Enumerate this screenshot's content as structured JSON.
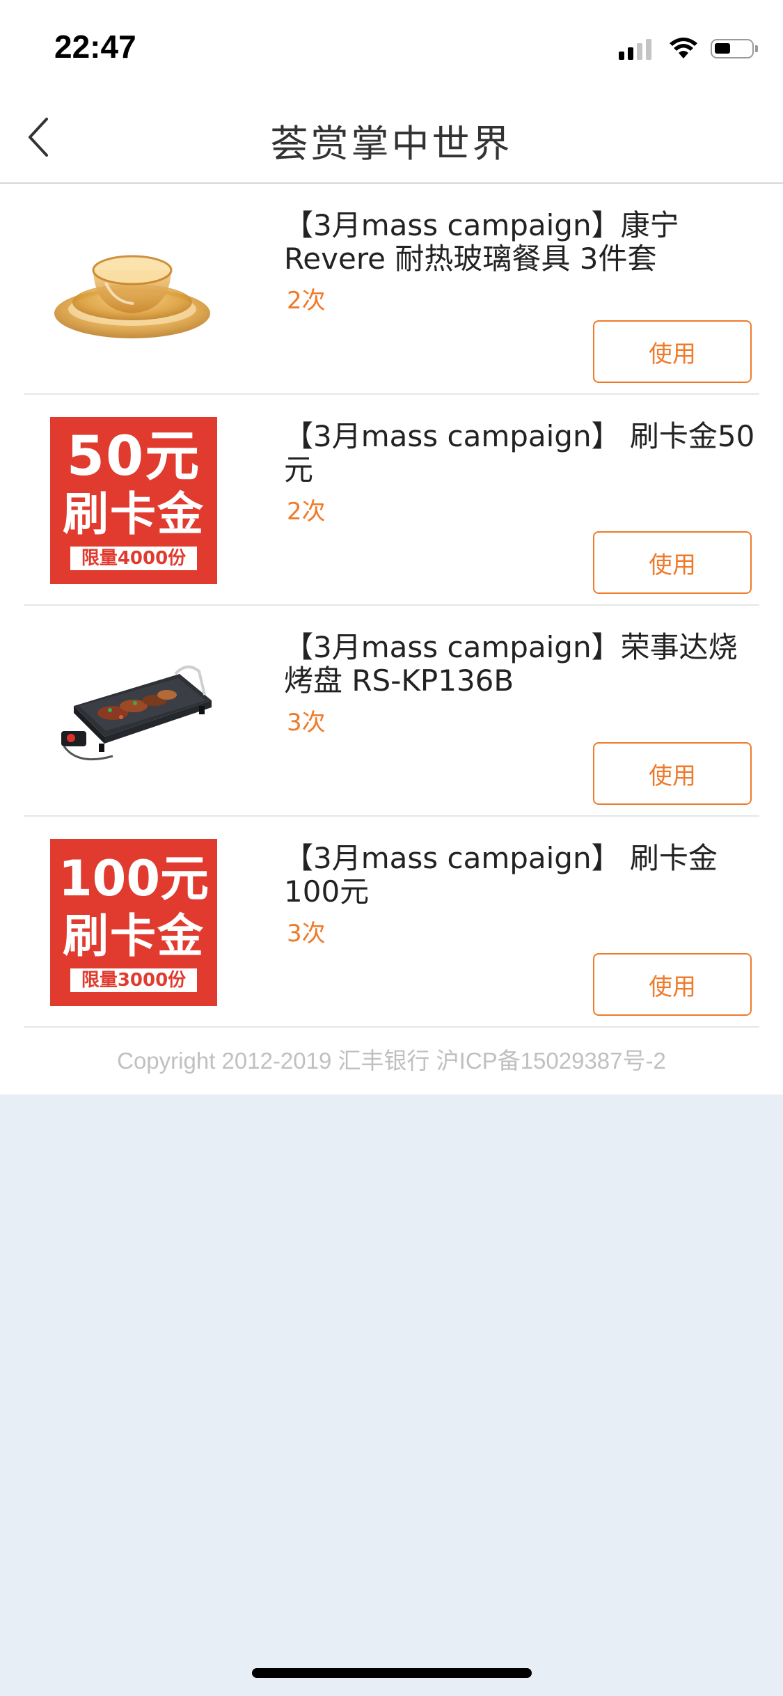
{
  "status_bar": {
    "time": "22:47"
  },
  "nav": {
    "title": "荟赏掌中世界",
    "back_icon": "chevron-left-icon"
  },
  "items": [
    {
      "title": "【3月mass campaign】康宁Revere 耐热玻璃餐具 3件套",
      "count": "2次",
      "button": "使用",
      "image": "amber-glass-dishware"
    },
    {
      "title": "【3月mass campaign】 刷卡金50元",
      "count": "2次",
      "button": "使用",
      "card": {
        "amount": "50元",
        "label": "刷卡金",
        "limit": "限量4000份"
      }
    },
    {
      "title": "【3月mass campaign】荣事达烧烤盘 RS-KP136B",
      "count": "3次",
      "button": "使用",
      "image": "electric-grill-pan"
    },
    {
      "title": "【3月mass campaign】 刷卡金100元",
      "count": "3次",
      "button": "使用",
      "card": {
        "amount": "100元",
        "label": "刷卡金",
        "limit": "限量3000份"
      }
    }
  ],
  "footer": {
    "copyright": "Copyright 2012-2019 汇丰银行 沪ICP备15029387号-2"
  },
  "colors": {
    "accent": "#ef7a2a",
    "card_red": "#e13a2e",
    "page_bg": "#e8eef6"
  }
}
